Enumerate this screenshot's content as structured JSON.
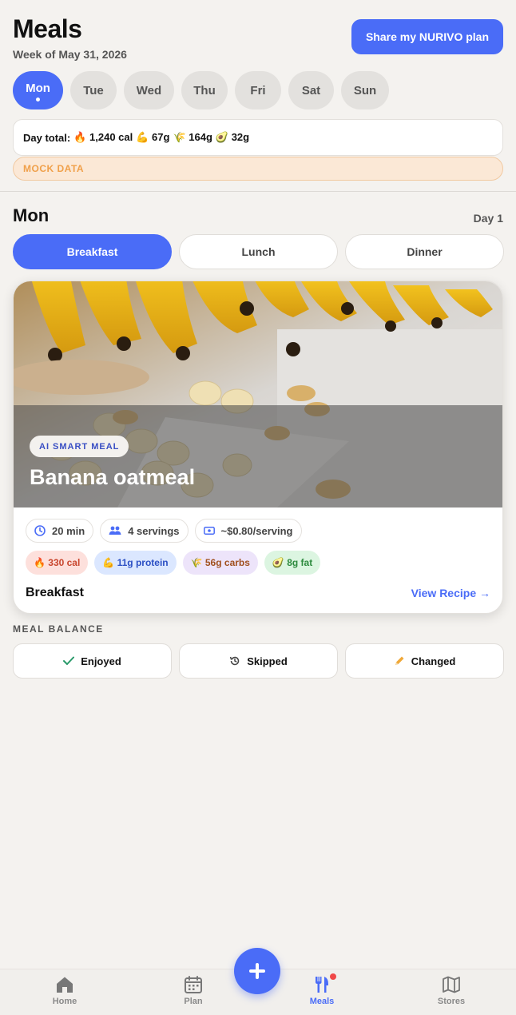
{
  "header": {
    "title": "Meals",
    "subtitle": "Week of May 31, 2026",
    "share_label": "Share my NURIVO plan"
  },
  "days": [
    {
      "label": "Mon",
      "active": true
    },
    {
      "label": "Tue",
      "active": false
    },
    {
      "label": "Wed",
      "active": false
    },
    {
      "label": "Thu",
      "active": false
    },
    {
      "label": "Fri",
      "active": false
    },
    {
      "label": "Sat",
      "active": false
    },
    {
      "label": "Sun",
      "active": false
    }
  ],
  "totals": {
    "prefix": "Day total:",
    "calories": "🔥 1,240 cal",
    "protein": "💪 67g",
    "carbs": "🌾 164g",
    "fat": "🥑 32g"
  },
  "mock_label": "MOCK DATA",
  "day_section": {
    "heading": "Mon",
    "day_number": "Day 1"
  },
  "meal_tabs": [
    {
      "label": "Breakfast",
      "active": true
    },
    {
      "label": "Lunch",
      "active": false
    },
    {
      "label": "Dinner",
      "active": false
    }
  ],
  "meal_card": {
    "badge": "AI SMART MEAL",
    "name": "Banana oatmeal",
    "time": "20 min",
    "servings": "4 servings",
    "cost": "~$0.80/serving",
    "macros": {
      "calories": "🔥 330 cal",
      "protein": "💪 11g protein",
      "carbs": "🌾 56g carbs",
      "fat": "🥑 8g fat"
    },
    "meal_type": "Breakfast",
    "view_recipe": "View Recipe →"
  },
  "balance": {
    "label": "MEAL BALANCE",
    "enjoyed": "Enjoyed",
    "skipped": "Skipped",
    "changed": "Changed"
  },
  "nav": {
    "home": "Home",
    "plan": "Plan",
    "meals": "Meals",
    "stores": "Stores"
  },
  "colors": {
    "accent": "#4a6cf7",
    "background": "#f4f2ef"
  }
}
